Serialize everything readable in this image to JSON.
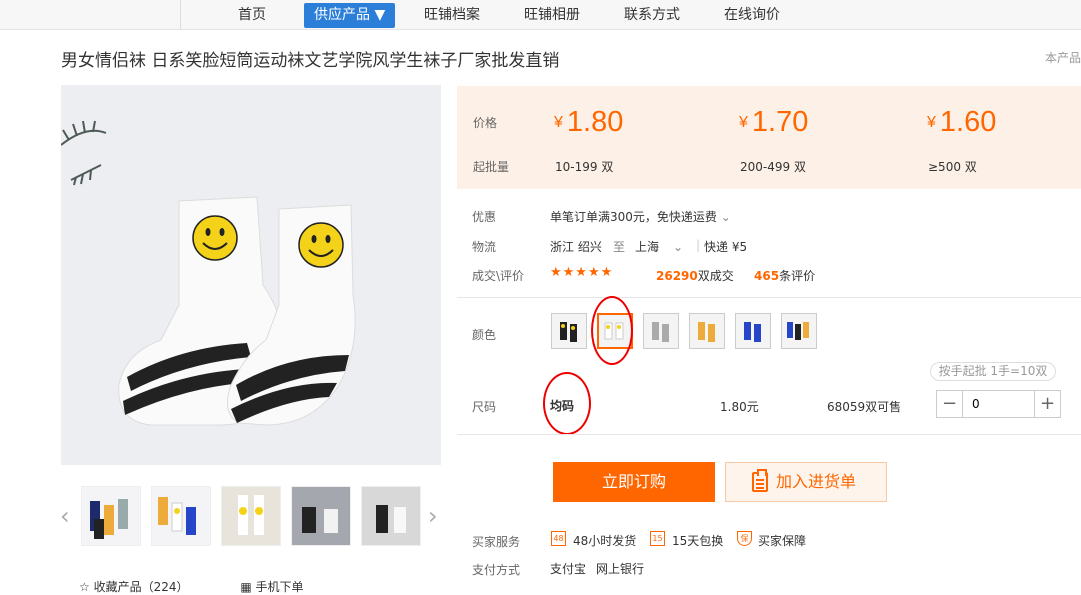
{
  "nav": {
    "items": [
      "首页",
      "供应产品 ▼",
      "旺铺档案",
      "旺铺相册",
      "联系方式",
      "在线询价"
    ]
  },
  "title": "男女情侣袜 日系笑脸短筒运动袜文艺学院风学生袜子厂家批发直销",
  "corner_text": "本产品",
  "price_band": {
    "price_label": "价格",
    "moq_label": "起批量",
    "currency": "¥",
    "tiers": [
      {
        "price": "1.80",
        "qty": "10-199 双"
      },
      {
        "price": "1.70",
        "qty": "200-499 双"
      },
      {
        "price": "1.60",
        "qty": "≥500 双"
      }
    ]
  },
  "info": {
    "promo_label": "优惠",
    "promo_text": "单笔订单满300元，免快递运费",
    "logistics_label": "物流",
    "from": "浙江  绍兴",
    "to_word": "至",
    "to": "上海",
    "shipping": "快递 ¥5",
    "deals_label": "成交\\评价",
    "stars": "★★★★★",
    "deals_count": "26290",
    "deals_unit": "双成交",
    "review_count": "465",
    "review_unit": "条评价"
  },
  "color_label": "颜色",
  "size": {
    "label": "尺码",
    "value": "均码",
    "price": "1.80元",
    "stock": "68059双可售",
    "batch_note": "按手起批 1手=10双",
    "quantity": "0"
  },
  "buttons": {
    "buy": "立即订购",
    "cart": "加入进货单"
  },
  "services": {
    "label": "买家服务",
    "items": [
      {
        "icon": "48",
        "text": "48小时发货"
      },
      {
        "icon": "15",
        "text": "15天包换"
      },
      {
        "icon": "保",
        "text": "买家保障"
      }
    ]
  },
  "payment": {
    "label": "支付方式",
    "methods": [
      "支付宝",
      "网上银行"
    ]
  },
  "bottom_links": {
    "favorite": "收藏产品（224）",
    "mobile": "手机下单"
  },
  "colors": {
    "accent": "#ff6600",
    "nav_active": "#2b7fd8",
    "price_band_bg": "#fdf0e6"
  }
}
